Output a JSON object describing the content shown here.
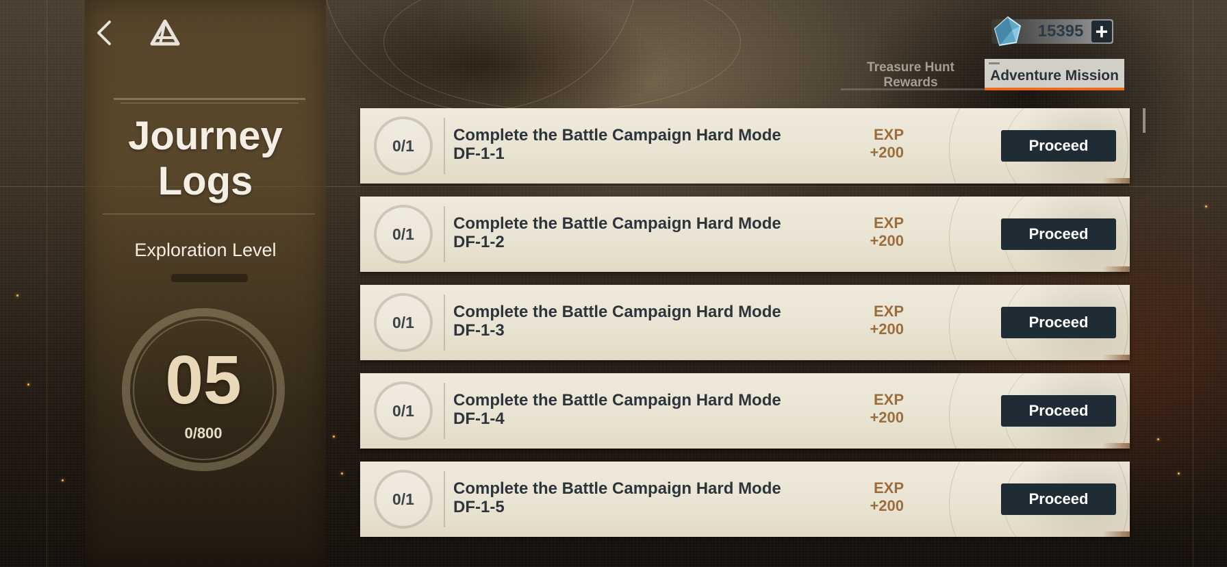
{
  "nav": {
    "back_icon": "chevron-left-icon",
    "home_icon": "home-triangle-icon"
  },
  "currency": {
    "icon": "crystal-gem-icon",
    "value": "15395",
    "add_label": "+"
  },
  "tabs": [
    {
      "label": "Treasure Hunt Rewards",
      "active": false
    },
    {
      "label": "Adventure Mission",
      "active": true
    }
  ],
  "left_panel": {
    "title_line1": "Journey",
    "title_line2": "Logs",
    "exploration_label": "Exploration Level",
    "level": "05",
    "progress": "0/800"
  },
  "missions": [
    {
      "progress": "0/1",
      "line1": "Complete the Battle Campaign Hard Mode",
      "line2": "DF-1-1",
      "exp_label": "EXP",
      "exp_value": "+200",
      "button": "Proceed"
    },
    {
      "progress": "0/1",
      "line1": "Complete the Battle Campaign Hard Mode",
      "line2": "DF-1-2",
      "exp_label": "EXP",
      "exp_value": "+200",
      "button": "Proceed"
    },
    {
      "progress": "0/1",
      "line1": "Complete the Battle Campaign Hard Mode",
      "line2": "DF-1-3",
      "exp_label": "EXP",
      "exp_value": "+200",
      "button": "Proceed"
    },
    {
      "progress": "0/1",
      "line1": "Complete the Battle Campaign Hard Mode",
      "line2": "DF-1-4",
      "exp_label": "EXP",
      "exp_value": "+200",
      "button": "Proceed"
    },
    {
      "progress": "0/1",
      "line1": "Complete the Battle Campaign Hard Mode",
      "line2": "DF-1-5",
      "exp_label": "EXP",
      "exp_value": "+200",
      "button": "Proceed"
    }
  ],
  "colors": {
    "accent_tab": "#f06a1c",
    "button_bg": "#1f2c36",
    "exp_text": "#9c6d3c",
    "card_bg": "#efeadc"
  }
}
